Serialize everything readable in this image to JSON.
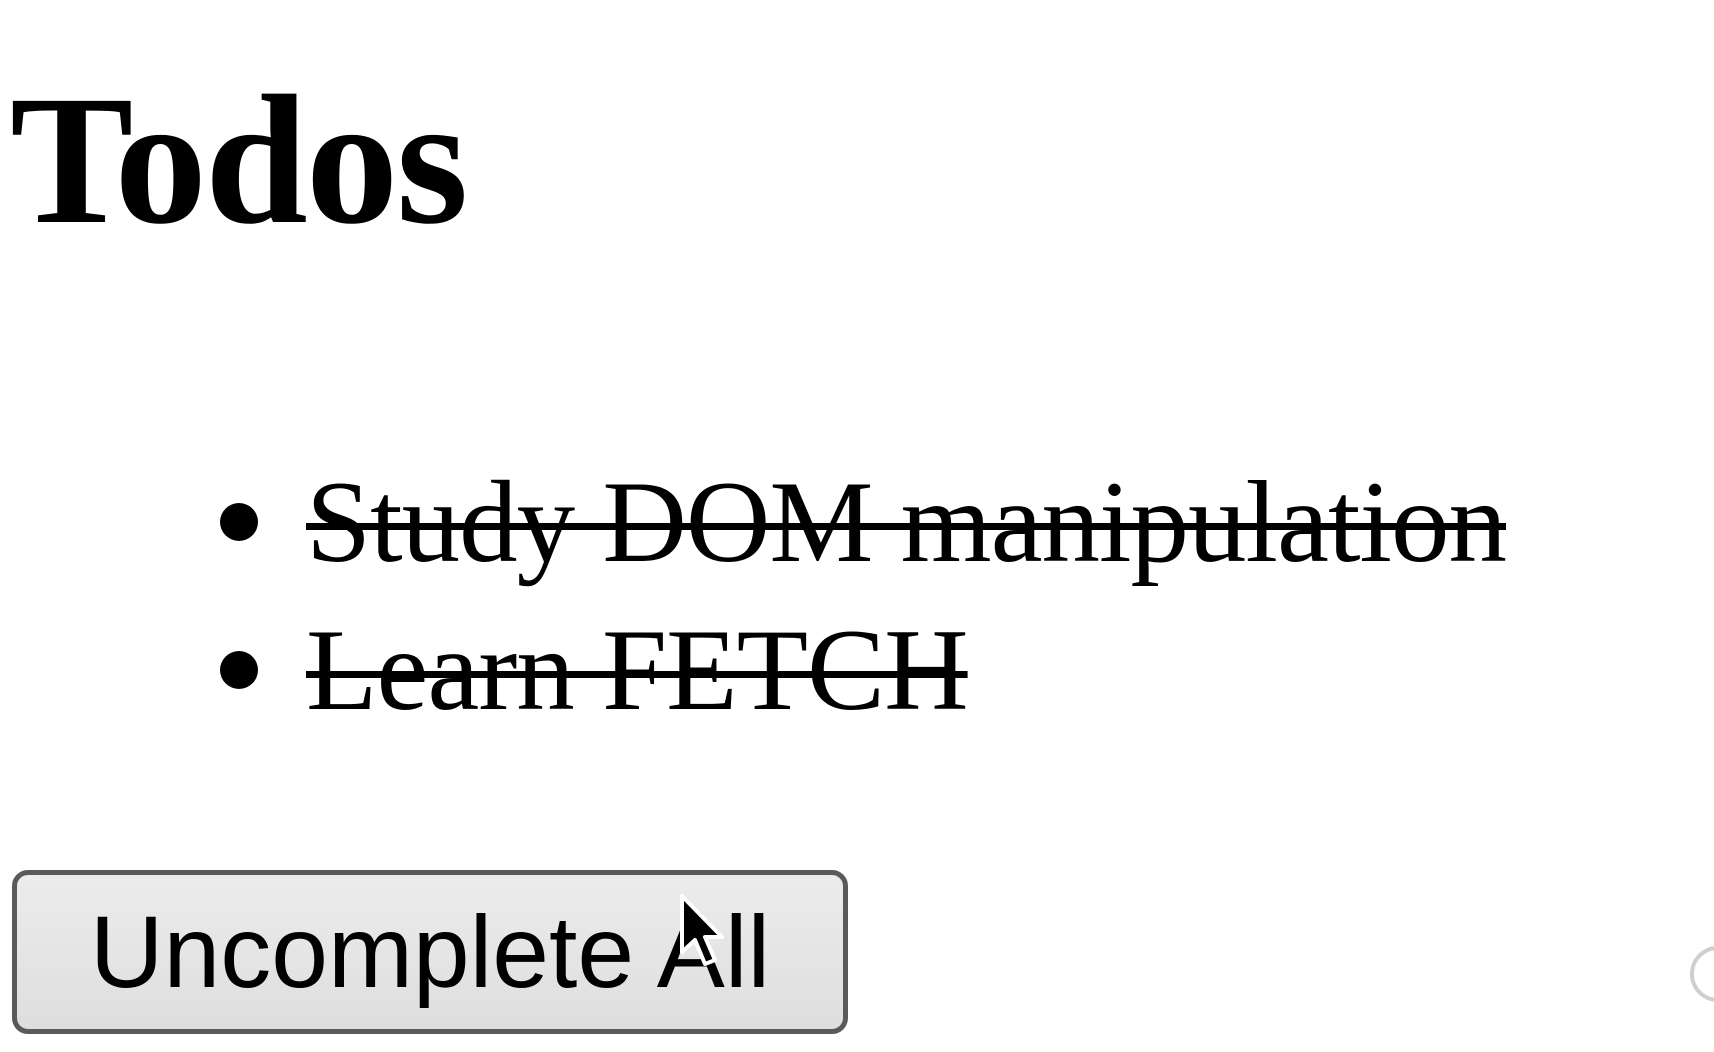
{
  "page": {
    "title": "Todos"
  },
  "todos": [
    {
      "text": "Study DOM manipulation",
      "completed": true
    },
    {
      "text": "Learn FETCH",
      "completed": true
    }
  ],
  "actions": {
    "uncomplete_all_label": "Uncomplete All"
  },
  "icons": {
    "cursor": "mouse-pointer-icon",
    "bullet": "bullet-icon",
    "edge": "partial-circle-icon"
  }
}
